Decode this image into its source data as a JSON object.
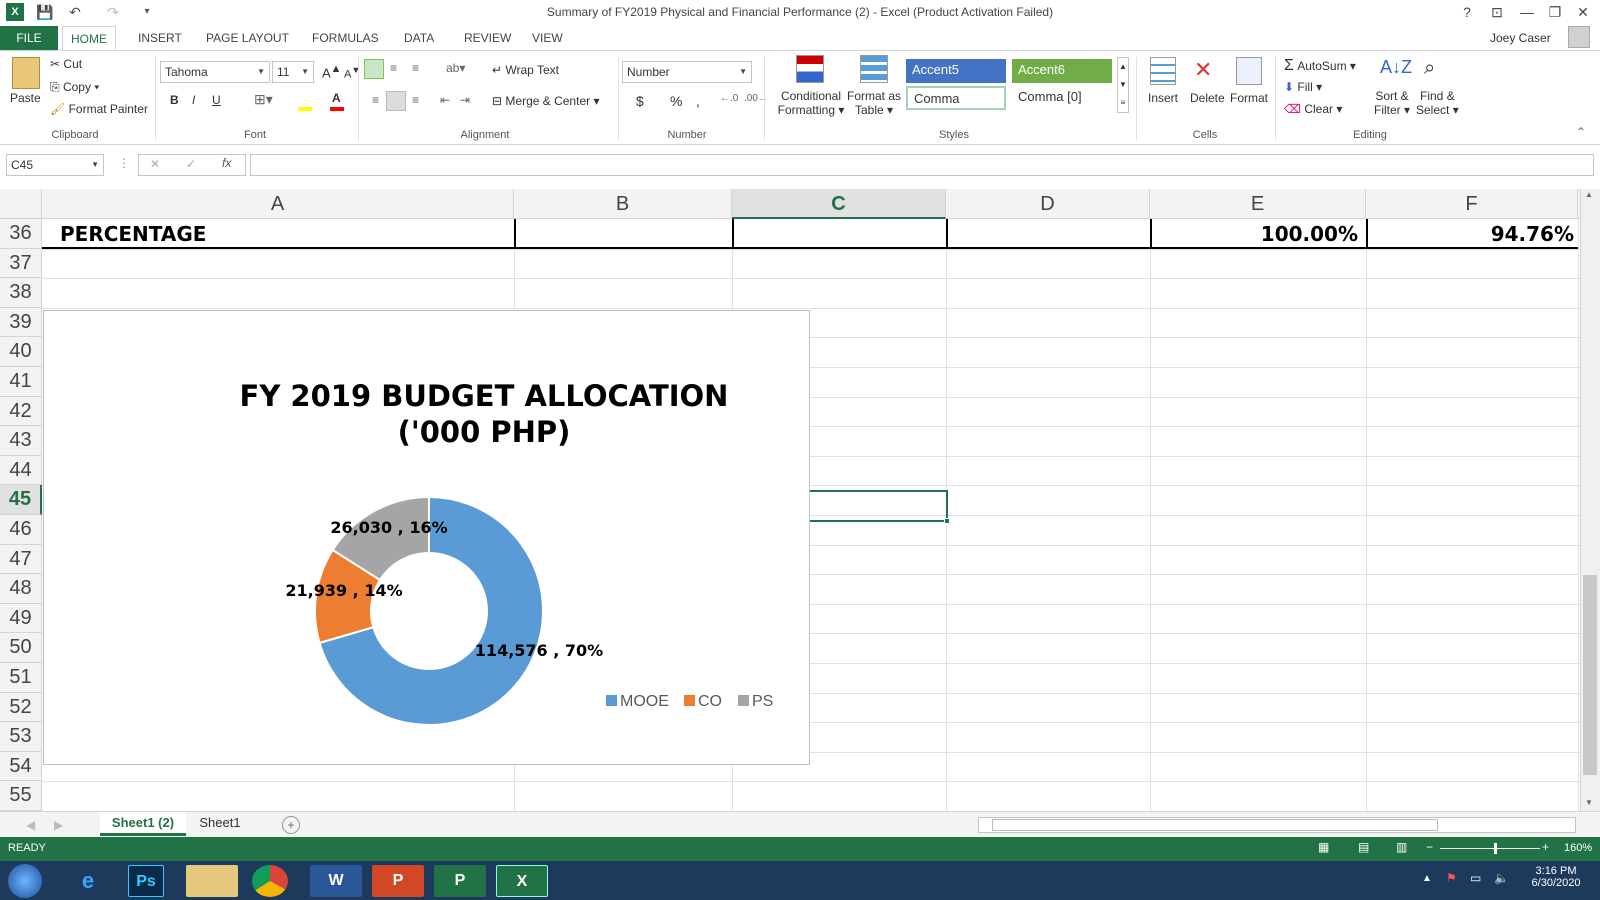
{
  "window": {
    "title": "Summary of FY2019 Physical and Financial Performance (2) - Excel (Product Activation Failed)",
    "user": "Joey Caser",
    "help": "?"
  },
  "ribbon_tabs": [
    "FILE",
    "HOME",
    "INSERT",
    "PAGE LAYOUT",
    "FORMULAS",
    "DATA",
    "REVIEW",
    "VIEW"
  ],
  "clipboard": {
    "paste": "Paste",
    "cut": "Cut",
    "copy": "Copy",
    "format_painter": "Format Painter",
    "group": "Clipboard"
  },
  "font": {
    "name": "Tahoma",
    "size": "11",
    "bold": "B",
    "italic": "I",
    "underline": "U",
    "group": "Font"
  },
  "alignment": {
    "wrap": "Wrap Text",
    "merge": "Merge & Center",
    "group": "Alignment"
  },
  "number": {
    "format": "Number",
    "currency": "$",
    "percent": "%",
    "comma": ",",
    "group": "Number"
  },
  "styles": {
    "conditional": "Conditional",
    "conditional2": "Formatting",
    "format_as": "Format as",
    "format_as2": "Table",
    "accent5": "Accent5",
    "accent6": "Accent6",
    "comma": "Comma",
    "comma0": "Comma [0]",
    "group": "Styles"
  },
  "cells": {
    "insert": "Insert",
    "delete": "Delete",
    "format": "Format",
    "group": "Cells"
  },
  "editing": {
    "autosum": "AutoSum",
    "fill": "Fill",
    "clear": "Clear",
    "sort": "Sort &",
    "sort2": "Filter",
    "find": "Find &",
    "find2": "Select",
    "group": "Editing"
  },
  "formula_bar": {
    "name_box": "C45",
    "fx": "fx",
    "value": ""
  },
  "columns": [
    "A",
    "B",
    "C",
    "D",
    "E",
    "F"
  ],
  "rows": [
    "36",
    "37",
    "38",
    "39",
    "40",
    "41",
    "42",
    "43",
    "44",
    "45",
    "46",
    "47",
    "48",
    "49",
    "50",
    "51",
    "52",
    "53",
    "54",
    "55"
  ],
  "row36": {
    "a": "PERCENTAGE",
    "e": "100.00%",
    "f": "94.76%"
  },
  "chart_data": {
    "type": "pie",
    "donut": true,
    "title": "FY 2019 BUDGET ALLOCATION ('000 PHP)",
    "title_line1": "FY 2019 BUDGET ALLOCATION",
    "title_line2": "('000 PHP)",
    "categories": [
      "MOOE",
      "CO",
      "PS"
    ],
    "values": [
      114576,
      21939,
      26030
    ],
    "percents": [
      70,
      14,
      16
    ],
    "labels": [
      "114,576 , 70%",
      "21,939 , 14%",
      "26,030 , 16%"
    ],
    "colors": [
      "#5b9bd5",
      "#ed7d31",
      "#a5a5a5"
    ],
    "legend_position": "bottom-right"
  },
  "sheet_tabs": [
    "Sheet1 (2)",
    "Sheet1"
  ],
  "status": {
    "ready": "READY",
    "zoom": "160%"
  },
  "clock": {
    "time": "3:16 PM",
    "date": "6/30/2020"
  }
}
